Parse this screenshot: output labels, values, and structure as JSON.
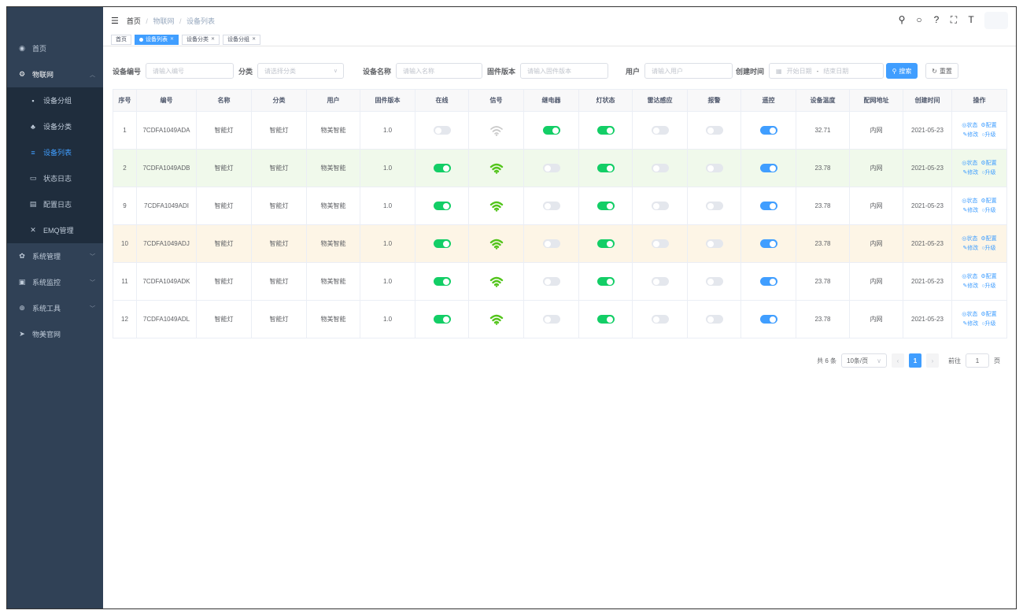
{
  "sidebar": {
    "items": [
      {
        "icon": "dashboard-icon",
        "glyph": "◉",
        "label": "首页"
      },
      {
        "icon": "iot-icon",
        "glyph": "⚙",
        "label": "物联网"
      }
    ],
    "iot_sub": [
      {
        "glyph": "▪",
        "icon": "group-icon",
        "label": "设备分组"
      },
      {
        "glyph": "♣",
        "icon": "tree-icon",
        "label": "设备分类"
      },
      {
        "glyph": "≡",
        "icon": "list-icon",
        "label": "设备列表"
      },
      {
        "glyph": "▭",
        "icon": "log-icon",
        "label": "状态日志"
      },
      {
        "glyph": "▤",
        "icon": "config-log-icon",
        "label": "配置日志"
      },
      {
        "glyph": "✕",
        "icon": "emq-icon",
        "label": "EMQ管理"
      }
    ],
    "bottom_items": [
      {
        "glyph": "✿",
        "icon": "system-icon",
        "label": "系统管理"
      },
      {
        "glyph": "▣",
        "icon": "monitor-icon",
        "label": "系统监控"
      },
      {
        "glyph": "⊕",
        "icon": "tool-icon",
        "label": "系统工具"
      },
      {
        "glyph": "➤",
        "icon": "guide-icon",
        "label": "物美官网"
      }
    ]
  },
  "navbar": {
    "hamburger": "☰",
    "breadcrumb": [
      "首页",
      "物联网",
      "设备列表"
    ],
    "sep": "/",
    "icons": [
      {
        "name": "search-icon",
        "glyph": "⚲"
      },
      {
        "name": "github-icon",
        "glyph": "○"
      },
      {
        "name": "help-icon",
        "glyph": "?"
      },
      {
        "name": "fullscreen-icon",
        "glyph": "⛶"
      },
      {
        "name": "font-size-icon",
        "glyph": "T"
      }
    ]
  },
  "tags": [
    "首页",
    "设备列表",
    "设备分类",
    "设备分组"
  ],
  "search": {
    "labels": {
      "device_no": "设备编号",
      "category": "分类",
      "device_name": "设备名称",
      "firmware": "固件版本",
      "user": "用户",
      "created": "创建时间"
    },
    "placeholders": {
      "device_no": "请输入编号",
      "category": "请选择分类",
      "device_name": "请输入名称",
      "firmware": "请输入固件版本",
      "user": "请输入用户",
      "start_date": "开始日期",
      "end_date": "结束日期"
    },
    "range_sep": "-",
    "search_btn": "搜索",
    "reset_btn": "重置"
  },
  "table": {
    "columns": [
      "序号",
      "编号",
      "名称",
      "分类",
      "用户",
      "固件版本",
      "在线",
      "信号",
      "继电器",
      "灯状态",
      "雷达感应",
      "报警",
      "遥控",
      "设备温度",
      "配网地址",
      "创建时间",
      "操作"
    ],
    "ops": [
      "◎状态",
      "⚙配置",
      "✎修改",
      "○升级"
    ],
    "rows": [
      {
        "idx": "1",
        "code": "7CDFA1049ADA",
        "name": "智能灯",
        "category": "智能灯",
        "user": "物美智能",
        "firmware": "1.0",
        "online": false,
        "signal_strong": false,
        "relay": true,
        "light": true,
        "radar": false,
        "alarm": false,
        "remote": true,
        "temp": "32.71",
        "network": "内网",
        "created": "2021-05-23",
        "style": ""
      },
      {
        "idx": "2",
        "code": "7CDFA1049ADB",
        "name": "智能灯",
        "category": "智能灯",
        "user": "物美智能",
        "firmware": "1.0",
        "online": true,
        "signal_strong": true,
        "relay": false,
        "light": true,
        "radar": false,
        "alarm": false,
        "remote": true,
        "temp": "23.78",
        "network": "内网",
        "created": "2021-05-23",
        "style": "success"
      },
      {
        "idx": "9",
        "code": "7CDFA1049ADI",
        "name": "智能灯",
        "category": "智能灯",
        "user": "物美智能",
        "firmware": "1.0",
        "online": true,
        "signal_strong": true,
        "relay": false,
        "light": true,
        "radar": false,
        "alarm": false,
        "remote": true,
        "temp": "23.78",
        "network": "内网",
        "created": "2021-05-23",
        "style": ""
      },
      {
        "idx": "10",
        "code": "7CDFA1049ADJ",
        "name": "智能灯",
        "category": "智能灯",
        "user": "物美智能",
        "firmware": "1.0",
        "online": true,
        "signal_strong": true,
        "relay": false,
        "light": true,
        "radar": false,
        "alarm": false,
        "remote": true,
        "temp": "23.78",
        "network": "内网",
        "created": "2021-05-23",
        "style": "warning"
      },
      {
        "idx": "11",
        "code": "7CDFA1049ADK",
        "name": "智能灯",
        "category": "智能灯",
        "user": "物美智能",
        "firmware": "1.0",
        "online": true,
        "signal_strong": true,
        "relay": false,
        "light": true,
        "radar": false,
        "alarm": false,
        "remote": true,
        "temp": "23.78",
        "network": "内网",
        "created": "2021-05-23",
        "style": ""
      },
      {
        "idx": "12",
        "code": "7CDFA1049ADL",
        "name": "智能灯",
        "category": "智能灯",
        "user": "物美智能",
        "firmware": "1.0",
        "online": true,
        "signal_strong": true,
        "relay": false,
        "light": true,
        "radar": false,
        "alarm": false,
        "remote": true,
        "temp": "23.78",
        "network": "内网",
        "created": "2021-05-23",
        "style": ""
      }
    ]
  },
  "pagination": {
    "total": "共 6 条",
    "page_size": "10条/页",
    "current": "1",
    "goto_label": "前往",
    "goto_value": "1",
    "page_unit": "页",
    "prev": "‹",
    "next": "›"
  },
  "colors": {
    "accent": "#409eff",
    "switch_green": "#13ce66",
    "signal_on": "#52c41a",
    "signal_off": "#c8c8c8"
  }
}
